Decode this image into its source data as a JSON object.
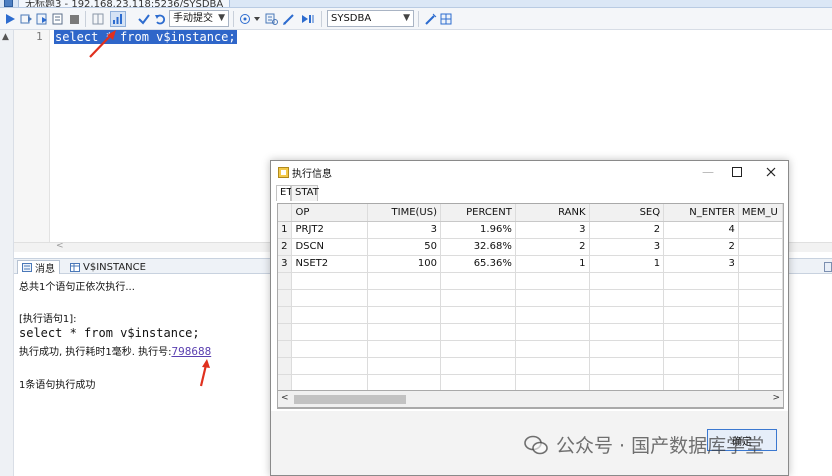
{
  "document_tab": {
    "title": "无标题3 - 192.168.23.118:5236/SYSDBA"
  },
  "toolbar": {
    "commit_mode": "手动提交",
    "connection": "SYSDBA"
  },
  "editor": {
    "line_number": "1",
    "code": "select * from v$instance;"
  },
  "bottom_panel": {
    "tabs": [
      {
        "label": "消息"
      },
      {
        "label": "V$INSTANCE"
      }
    ],
    "messages": {
      "line1": "总共1个语句正依次执行...",
      "line2": "[执行语句1]:",
      "line3": "select * from v$instance;",
      "line4_prefix": "执行成功, 执行耗时1毫秒. 执行号:",
      "exec_number": "798688",
      "line5": "1条语句执行成功"
    }
  },
  "dialog": {
    "title": "执行信息",
    "tabs": [
      {
        "label": "ET"
      },
      {
        "label": "STAT"
      }
    ],
    "columns": [
      "OP",
      "TIME(US)",
      "PERCENT",
      "RANK",
      "SEQ",
      "N_ENTER",
      "MEM_U"
    ],
    "rows": [
      {
        "n": "1",
        "cells": [
          "PRJT2",
          "3",
          "1.96%",
          "3",
          "2",
          "4",
          ""
        ]
      },
      {
        "n": "2",
        "cells": [
          "DSCN",
          "50",
          "32.68%",
          "2",
          "3",
          "2",
          ""
        ]
      },
      {
        "n": "3",
        "cells": [
          "NSET2",
          "100",
          "65.36%",
          "1",
          "1",
          "3",
          ""
        ]
      }
    ],
    "ok_label": "确定"
  },
  "watermark": {
    "text": "公众号 · 国产数据库学堂"
  },
  "colors": {
    "selection": "#2f66c9",
    "arrow": "#e0301e",
    "exec_link": "#5a3fb0"
  }
}
